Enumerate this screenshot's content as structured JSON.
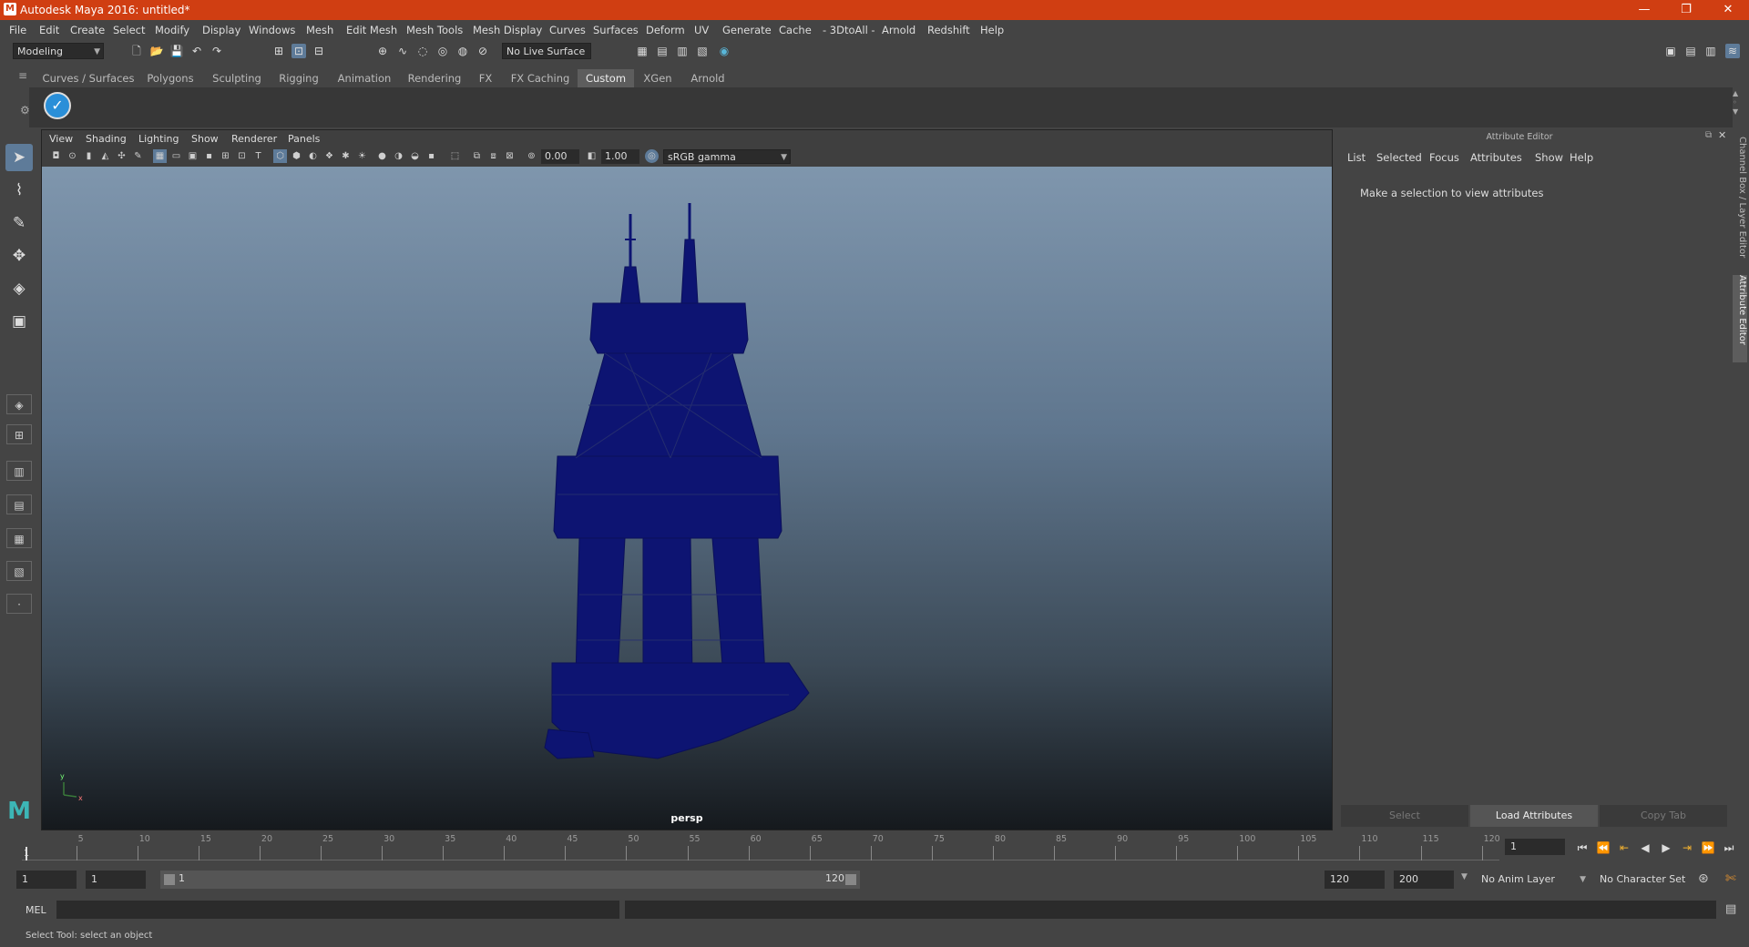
{
  "window": {
    "title": "Autodesk Maya 2016: untitled*",
    "logo": "M",
    "minimize": "—",
    "maximize": "❐",
    "close": "✕"
  },
  "menubar": [
    "File",
    "Edit",
    "Create",
    "Select",
    "Modify",
    "Display",
    "Windows",
    "Mesh",
    "Edit Mesh",
    "Mesh Tools",
    "Mesh Display",
    "Curves",
    "Surfaces",
    "Deform",
    "UV",
    "Generate",
    "Cache",
    "- 3DtoAll -",
    "Arnold",
    "Redshift",
    "Help"
  ],
  "statusline": {
    "menuset": "Modeling",
    "live_surface": "No Live Surface"
  },
  "shelf_tabs": [
    {
      "label": "Curves / Surfaces",
      "active": false
    },
    {
      "label": "Polygons",
      "active": false
    },
    {
      "label": "Sculpting",
      "active": false
    },
    {
      "label": "Rigging",
      "active": false
    },
    {
      "label": "Animation",
      "active": false
    },
    {
      "label": "Rendering",
      "active": false
    },
    {
      "label": "FX",
      "active": false
    },
    {
      "label": "FX Caching",
      "active": false
    },
    {
      "label": "Custom",
      "active": true
    },
    {
      "label": "XGen",
      "active": false
    },
    {
      "label": "Arnold",
      "active": false
    }
  ],
  "viewport": {
    "menu": [
      "View",
      "Shading",
      "Lighting",
      "Show",
      "Renderer",
      "Panels"
    ],
    "exposure": "0.00",
    "gamma": "1.00",
    "color_space": "sRGB gamma",
    "camera_label": "persp",
    "axis_y": "y",
    "axis_x": "x"
  },
  "attribute_editor": {
    "title": "Attribute Editor",
    "menu": [
      "List",
      "Selected",
      "Focus",
      "Attributes",
      "Show",
      "Help"
    ],
    "message": "Make a selection to view attributes",
    "buttons": {
      "select": "Select",
      "load": "Load Attributes",
      "copy": "Copy Tab"
    }
  },
  "side_tabs": {
    "channel_box": "Channel Box / Layer Editor",
    "attribute_editor": "Attribute Editor"
  },
  "timeline": {
    "ticks": [
      "5",
      "10",
      "15",
      "20",
      "25",
      "30",
      "35",
      "40",
      "45",
      "50",
      "55",
      "60",
      "65",
      "70",
      "75",
      "80",
      "85",
      "90",
      "95",
      "100",
      "105",
      "110",
      "115",
      "120"
    ],
    "start_marker": "1",
    "current_frame": "1"
  },
  "range": {
    "start": "1",
    "playback_start": "1",
    "range_left": "1",
    "range_right": "120",
    "playback_end": "120",
    "end": "200",
    "anim_layer": "No Anim Layer",
    "char_set": "No Character Set"
  },
  "command_line": {
    "label": "MEL"
  },
  "help_line": "Select Tool: select an object"
}
